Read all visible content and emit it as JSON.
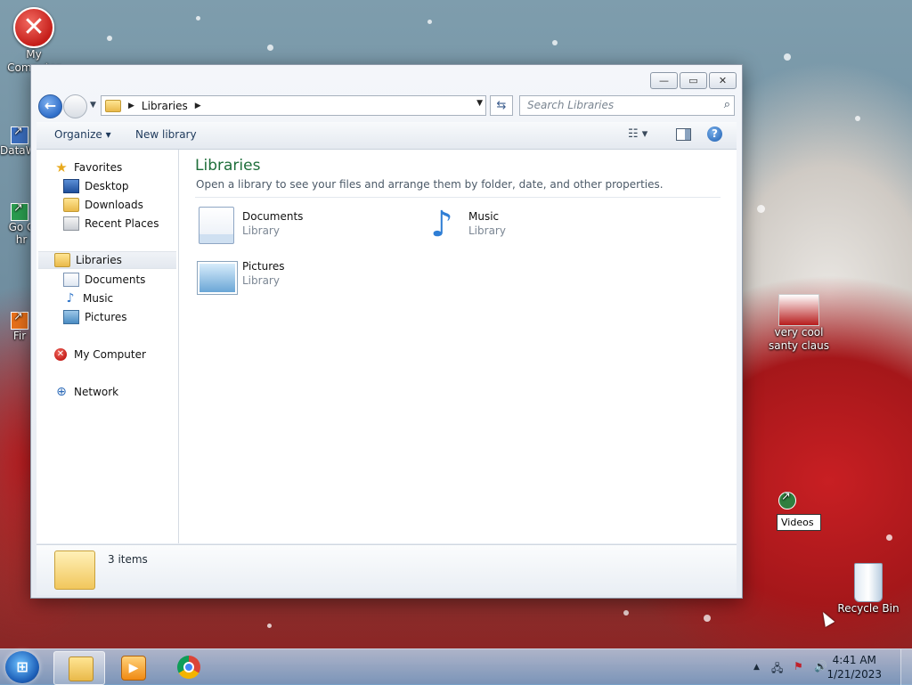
{
  "desktop": {
    "icons": [
      {
        "label": "My Computer",
        "icon": "error-x-icon"
      },
      {
        "label": "DataW",
        "icon": "shortcut-icon"
      },
      {
        "label": "Go Chr",
        "icon": "chrome-shortcut-icon"
      },
      {
        "label": "Fir",
        "icon": "firefox-shortcut-icon"
      },
      {
        "label": "very cool santy claus",
        "icon": "image-thumbnail-icon"
      },
      {
        "label": "Videos",
        "icon": "shortcut-icon"
      },
      {
        "label": "Recycle Bin",
        "icon": "recycle-bin-icon"
      }
    ],
    "rename_value": "Videos"
  },
  "window": {
    "controls": {
      "minimize": "—",
      "maximize": "▭",
      "close": "✕"
    },
    "address": {
      "crumbs": [
        "Libraries"
      ]
    },
    "search_placeholder": "Search Libraries",
    "toolbar": {
      "organize": "Organize ▾",
      "new_library": "New library",
      "help": "?"
    },
    "nav": {
      "favorites": "Favorites",
      "desktop": "Desktop",
      "downloads": "Downloads",
      "recent": "Recent Places",
      "libraries": "Libraries",
      "documents": "Documents",
      "music": "Music",
      "pictures": "Pictures",
      "computer": "My Computer",
      "network": "Network"
    },
    "content": {
      "title": "Libraries",
      "subtitle": "Open a library to see your files and arrange them by folder, date, and other properties.",
      "items": [
        {
          "name": "Documents",
          "type": "Library"
        },
        {
          "name": "Music",
          "type": "Library"
        },
        {
          "name": "Pictures",
          "type": "Library"
        }
      ]
    },
    "details": {
      "count": "3 items"
    }
  },
  "taskbar": {
    "clock_time": "4:41 AM",
    "clock_date": "1/21/2023",
    "apps": [
      "explorer-icon",
      "media-player-icon",
      "chrome-icon"
    ]
  }
}
